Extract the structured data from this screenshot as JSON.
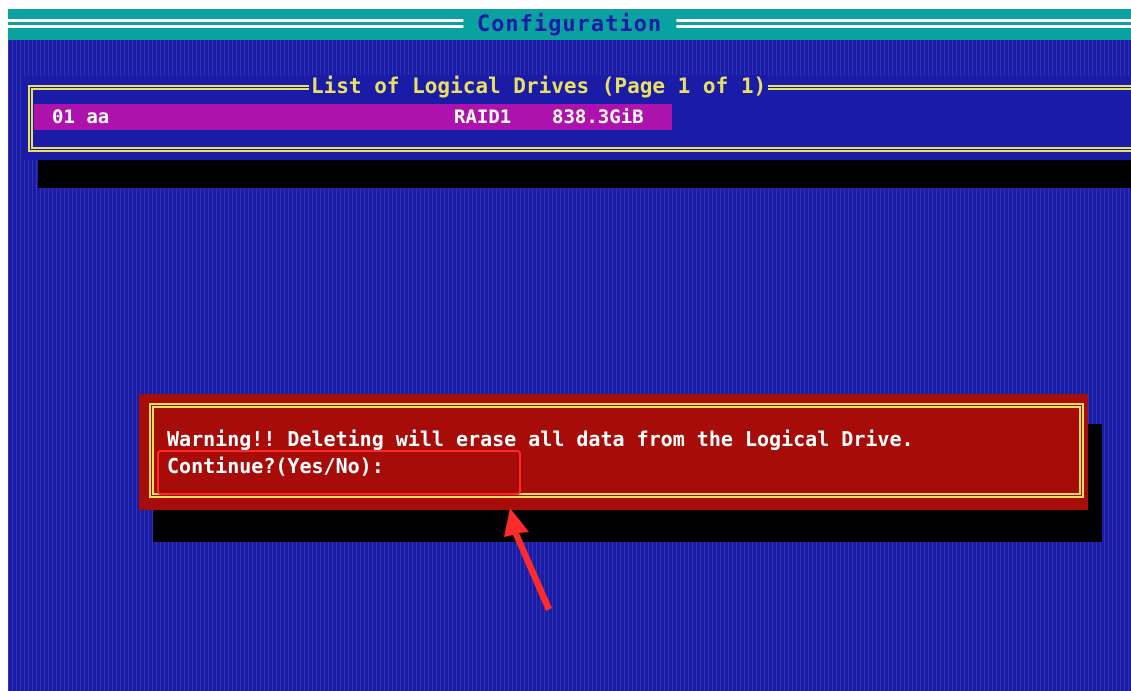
{
  "window": {
    "title": "Configuration"
  },
  "drive_list": {
    "title": "List of Logical Drives (Page 1 of 1)",
    "drives": [
      {
        "id": "01 aa",
        "raid_level": "RAID1",
        "size": "838.3GiB"
      }
    ]
  },
  "dialog": {
    "warning": "Warning!! Deleting will erase all data from the Logical Drive.",
    "prompt": "Continue?(Yes/No):"
  },
  "colors": {
    "background": "#1a1ca8",
    "title_bar": "#0aa1a1",
    "selection": "#ad12ad",
    "dialog": "#a80c08",
    "border": "#e8e060",
    "annotation": "#ff2a2a"
  }
}
